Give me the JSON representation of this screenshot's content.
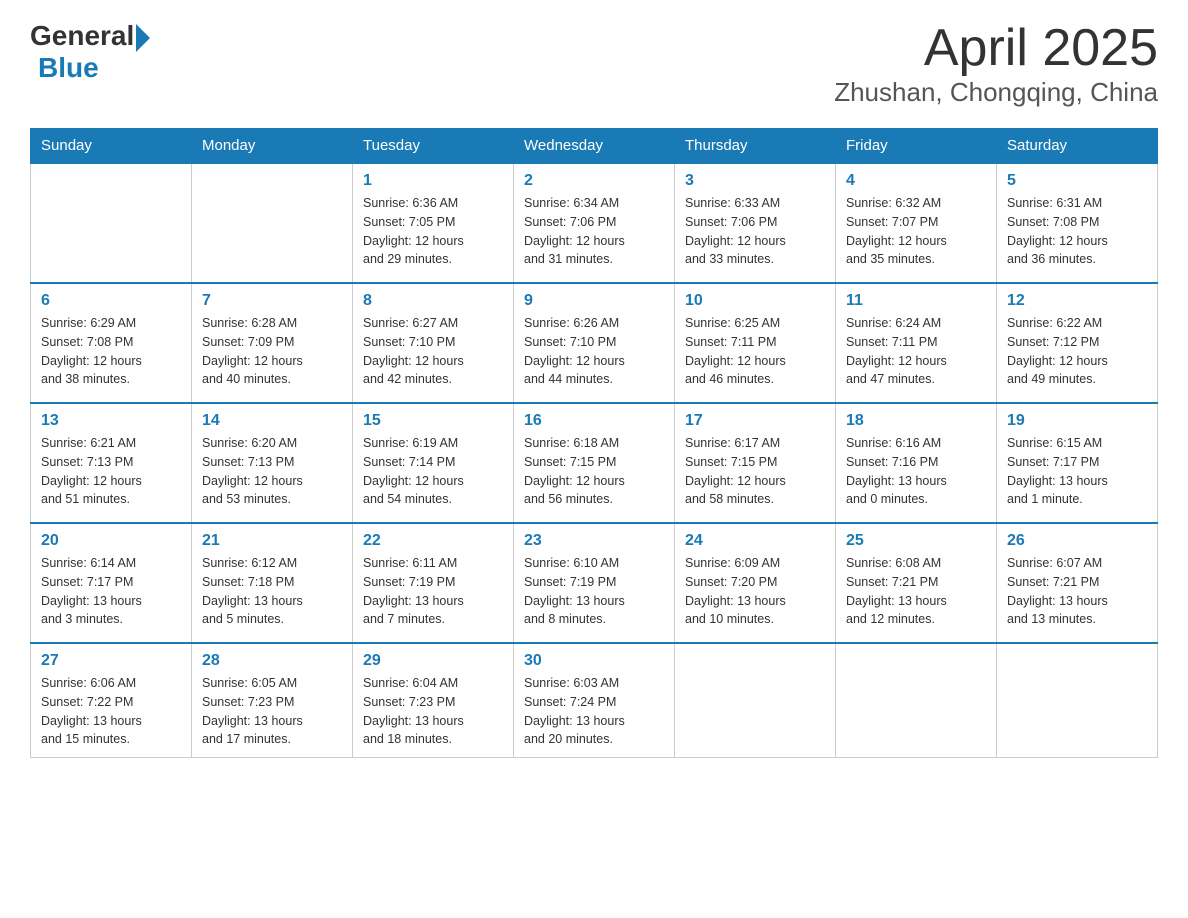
{
  "logo": {
    "text_general": "General",
    "text_blue": "Blue"
  },
  "title": "April 2025",
  "subtitle": "Zhushan, Chongqing, China",
  "headers": [
    "Sunday",
    "Monday",
    "Tuesday",
    "Wednesday",
    "Thursday",
    "Friday",
    "Saturday"
  ],
  "weeks": [
    [
      {
        "day": "",
        "info": ""
      },
      {
        "day": "",
        "info": ""
      },
      {
        "day": "1",
        "info": "Sunrise: 6:36 AM\nSunset: 7:05 PM\nDaylight: 12 hours\nand 29 minutes."
      },
      {
        "day": "2",
        "info": "Sunrise: 6:34 AM\nSunset: 7:06 PM\nDaylight: 12 hours\nand 31 minutes."
      },
      {
        "day": "3",
        "info": "Sunrise: 6:33 AM\nSunset: 7:06 PM\nDaylight: 12 hours\nand 33 minutes."
      },
      {
        "day": "4",
        "info": "Sunrise: 6:32 AM\nSunset: 7:07 PM\nDaylight: 12 hours\nand 35 minutes."
      },
      {
        "day": "5",
        "info": "Sunrise: 6:31 AM\nSunset: 7:08 PM\nDaylight: 12 hours\nand 36 minutes."
      }
    ],
    [
      {
        "day": "6",
        "info": "Sunrise: 6:29 AM\nSunset: 7:08 PM\nDaylight: 12 hours\nand 38 minutes."
      },
      {
        "day": "7",
        "info": "Sunrise: 6:28 AM\nSunset: 7:09 PM\nDaylight: 12 hours\nand 40 minutes."
      },
      {
        "day": "8",
        "info": "Sunrise: 6:27 AM\nSunset: 7:10 PM\nDaylight: 12 hours\nand 42 minutes."
      },
      {
        "day": "9",
        "info": "Sunrise: 6:26 AM\nSunset: 7:10 PM\nDaylight: 12 hours\nand 44 minutes."
      },
      {
        "day": "10",
        "info": "Sunrise: 6:25 AM\nSunset: 7:11 PM\nDaylight: 12 hours\nand 46 minutes."
      },
      {
        "day": "11",
        "info": "Sunrise: 6:24 AM\nSunset: 7:11 PM\nDaylight: 12 hours\nand 47 minutes."
      },
      {
        "day": "12",
        "info": "Sunrise: 6:22 AM\nSunset: 7:12 PM\nDaylight: 12 hours\nand 49 minutes."
      }
    ],
    [
      {
        "day": "13",
        "info": "Sunrise: 6:21 AM\nSunset: 7:13 PM\nDaylight: 12 hours\nand 51 minutes."
      },
      {
        "day": "14",
        "info": "Sunrise: 6:20 AM\nSunset: 7:13 PM\nDaylight: 12 hours\nand 53 minutes."
      },
      {
        "day": "15",
        "info": "Sunrise: 6:19 AM\nSunset: 7:14 PM\nDaylight: 12 hours\nand 54 minutes."
      },
      {
        "day": "16",
        "info": "Sunrise: 6:18 AM\nSunset: 7:15 PM\nDaylight: 12 hours\nand 56 minutes."
      },
      {
        "day": "17",
        "info": "Sunrise: 6:17 AM\nSunset: 7:15 PM\nDaylight: 12 hours\nand 58 minutes."
      },
      {
        "day": "18",
        "info": "Sunrise: 6:16 AM\nSunset: 7:16 PM\nDaylight: 13 hours\nand 0 minutes."
      },
      {
        "day": "19",
        "info": "Sunrise: 6:15 AM\nSunset: 7:17 PM\nDaylight: 13 hours\nand 1 minute."
      }
    ],
    [
      {
        "day": "20",
        "info": "Sunrise: 6:14 AM\nSunset: 7:17 PM\nDaylight: 13 hours\nand 3 minutes."
      },
      {
        "day": "21",
        "info": "Sunrise: 6:12 AM\nSunset: 7:18 PM\nDaylight: 13 hours\nand 5 minutes."
      },
      {
        "day": "22",
        "info": "Sunrise: 6:11 AM\nSunset: 7:19 PM\nDaylight: 13 hours\nand 7 minutes."
      },
      {
        "day": "23",
        "info": "Sunrise: 6:10 AM\nSunset: 7:19 PM\nDaylight: 13 hours\nand 8 minutes."
      },
      {
        "day": "24",
        "info": "Sunrise: 6:09 AM\nSunset: 7:20 PM\nDaylight: 13 hours\nand 10 minutes."
      },
      {
        "day": "25",
        "info": "Sunrise: 6:08 AM\nSunset: 7:21 PM\nDaylight: 13 hours\nand 12 minutes."
      },
      {
        "day": "26",
        "info": "Sunrise: 6:07 AM\nSunset: 7:21 PM\nDaylight: 13 hours\nand 13 minutes."
      }
    ],
    [
      {
        "day": "27",
        "info": "Sunrise: 6:06 AM\nSunset: 7:22 PM\nDaylight: 13 hours\nand 15 minutes."
      },
      {
        "day": "28",
        "info": "Sunrise: 6:05 AM\nSunset: 7:23 PM\nDaylight: 13 hours\nand 17 minutes."
      },
      {
        "day": "29",
        "info": "Sunrise: 6:04 AM\nSunset: 7:23 PM\nDaylight: 13 hours\nand 18 minutes."
      },
      {
        "day": "30",
        "info": "Sunrise: 6:03 AM\nSunset: 7:24 PM\nDaylight: 13 hours\nand 20 minutes."
      },
      {
        "day": "",
        "info": ""
      },
      {
        "day": "",
        "info": ""
      },
      {
        "day": "",
        "info": ""
      }
    ]
  ]
}
